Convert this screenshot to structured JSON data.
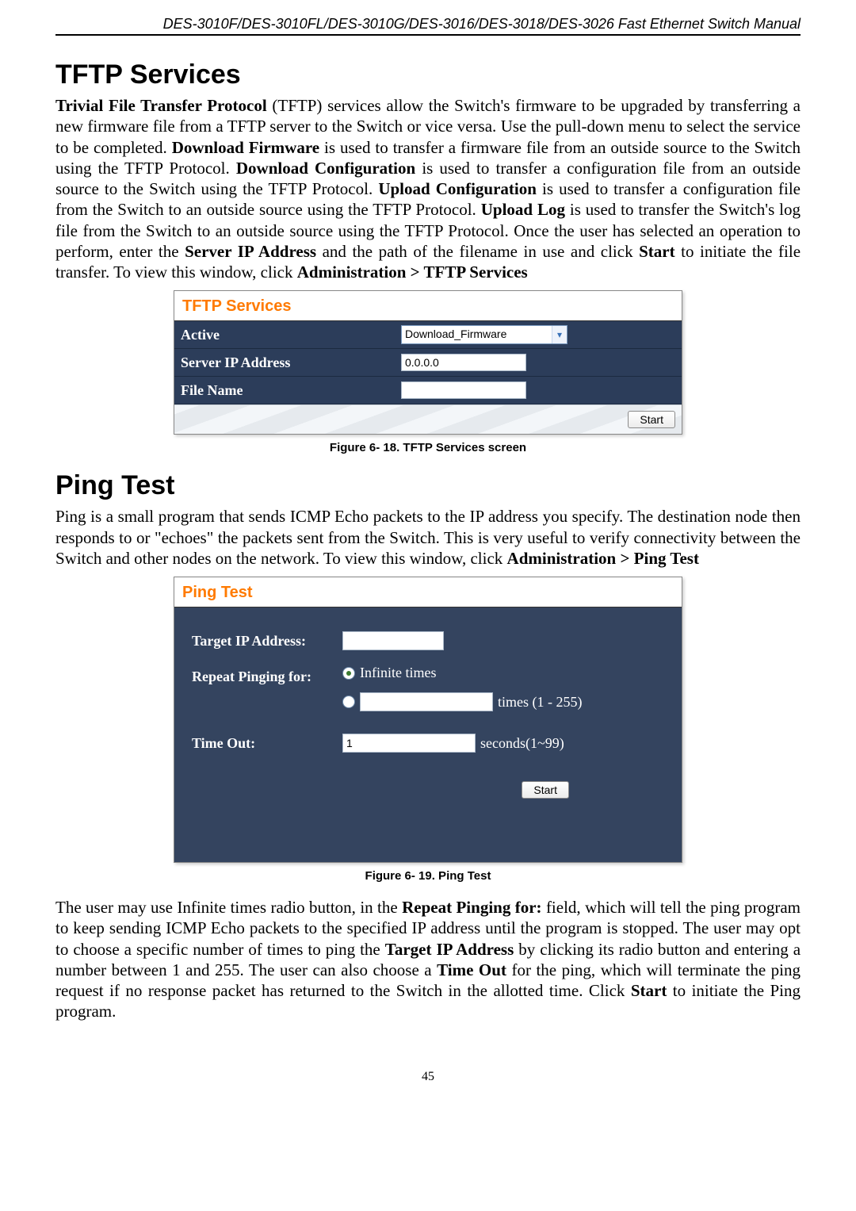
{
  "header": "DES-3010F/DES-3010FL/DES-3010G/DES-3016/DES-3018/DES-3026 Fast Ethernet Switch Manual",
  "page_number": "45",
  "tftp": {
    "heading": "TFTP Services",
    "paragraph_parts": {
      "p1a": "Trivial File Transfer Protocol",
      "p1b": " (TFTP) services allow the Switch's firmware to be upgraded by transferring a new firmware file from a TFTP server to the Switch or vice versa. Use the pull-down menu to select the service to be completed. ",
      "p1c": "Download Firmware",
      "p1d": " is used to transfer a firmware file from an outside source to the Switch using the TFTP Protocol. ",
      "p1e": "Download Configuration",
      "p1f": " is used to transfer a configuration file from an outside source to the Switch using the TFTP Protocol. ",
      "p1g": "Upload Configuration",
      "p1h": " is used to transfer a configuration file from the Switch to an outside source using the TFTP Protocol. ",
      "p1i": "Upload Log",
      "p1j": " is used to transfer the Switch's log file from the Switch to an outside source using the TFTP Protocol. Once the user has selected an operation to perform, enter the ",
      "p1k": "Server IP Address",
      "p1l": " and the path of the filename in use and click ",
      "p1m": "Start",
      "p1n": " to initiate the file transfer.  To view this window, click ",
      "p1o": "Administration > TFTP Services"
    },
    "panel": {
      "title": "TFTP Services",
      "row_active": "Active",
      "active_value": "Download_Firmware",
      "row_server": "Server IP Address",
      "server_value": "0.0.0.0",
      "row_file": "File Name",
      "file_value": "",
      "start_btn": "Start"
    },
    "caption": "Figure 6- 18. TFTP Services screen"
  },
  "ping": {
    "heading": "Ping Test",
    "p1a": "Ping is a small program that sends ICMP Echo packets to the IP address you specify. The destination node then responds to or \"echoes\" the packets sent from the Switch. This is very useful to verify connectivity between the Switch and other nodes on the network. To view this window, click ",
    "p1b": "Administration > Ping Test",
    "panel": {
      "title": "Ping Test",
      "target_label": "Target IP Address:",
      "repeat_label": "Repeat Pinging for:",
      "infinite_label": "Infinite times",
      "times_suffix": "times (1 - 255)",
      "timeout_label": "Time Out:",
      "timeout_value": "1",
      "timeout_suffix": "seconds(1~99)",
      "start_btn": "Start"
    },
    "caption": "Figure 6- 19. Ping Test",
    "p2a": "The user may use Infinite times radio button, in the ",
    "p2b": "Repeat Pinging for:",
    "p2c": " field, which will tell the ping program to keep sending ICMP Echo packets to the specified IP address until the program is stopped. The user may opt to choose a specific number of times to ping the ",
    "p2d": "Target IP Address",
    "p2e": " by clicking its radio button and entering a number between 1 and 255. The user can also choose a ",
    "p2f": "Time Out",
    "p2g": " for the ping, which will terminate the ping request if no response packet has returned to the Switch in the allotted time. Click ",
    "p2h": "Start",
    "p2i": " to initiate the Ping program."
  }
}
